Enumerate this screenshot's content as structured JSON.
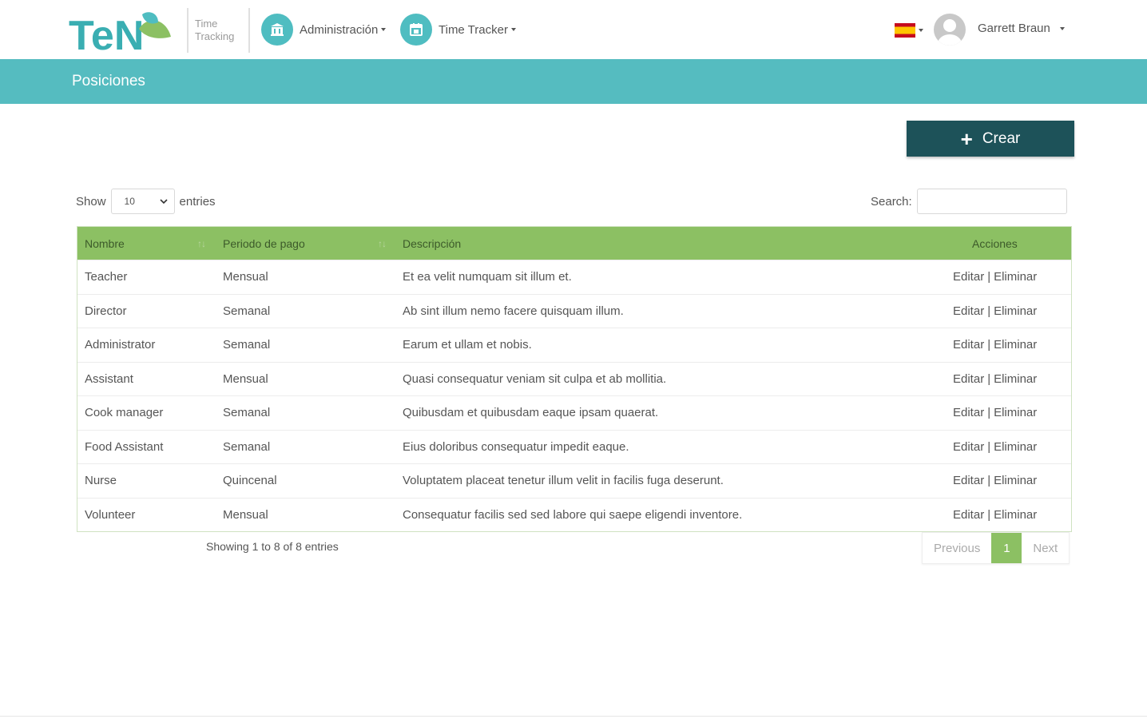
{
  "brand": {
    "logo_text": "TeN",
    "subtitle_line1": "Time",
    "subtitle_line2": "Tracking"
  },
  "nav": {
    "items": [
      {
        "label": "Administración",
        "icon": "bank-icon"
      },
      {
        "label": "Time Tracker",
        "icon": "calendar-icon"
      }
    ],
    "language_icon": "spain-flag-icon",
    "user_name": "Garrett Braun"
  },
  "page": {
    "title": "Posiciones"
  },
  "toolbar": {
    "create_label": "Crear"
  },
  "table_controls": {
    "show_label": "Show",
    "page_size": "10",
    "entries_label": "entries",
    "search_label": "Search:",
    "search_value": ""
  },
  "table": {
    "headers": [
      "Nombre",
      "Periodo de pago",
      "Descripción",
      "Acciones"
    ],
    "rows": [
      {
        "name": "Teacher",
        "period": "Mensual",
        "description": "Et ea velit numquam sit illum et."
      },
      {
        "name": "Director",
        "period": "Semanal",
        "description": "Ab sint illum nemo facere quisquam illum."
      },
      {
        "name": "Administrator",
        "period": "Semanal",
        "description": "Earum et ullam et nobis."
      },
      {
        "name": "Assistant",
        "period": "Mensual",
        "description": "Quasi consequatur veniam sit culpa et ab mollitia."
      },
      {
        "name": "Cook manager",
        "period": "Semanal",
        "description": "Quibusdam et quibusdam eaque ipsam quaerat."
      },
      {
        "name": "Food Assistant",
        "period": "Semanal",
        "description": "Eius doloribus consequatur impedit eaque."
      },
      {
        "name": "Nurse",
        "period": "Quincenal",
        "description": "Voluptatem placeat tenetur illum velit in facilis fuga deserunt."
      },
      {
        "name": "Volunteer",
        "period": "Mensual",
        "description": "Consequatur facilis sed sed labore qui saepe eligendi inventore."
      }
    ],
    "edit_label": "Editar",
    "separator": "|",
    "delete_label": "Eliminar"
  },
  "footer": {
    "info": "Showing 1 to 8 of 8 entries",
    "previous": "Previous",
    "current_page": "1",
    "next": "Next"
  },
  "colors": {
    "teal": "#55bcc0",
    "dark_teal": "#1d5259",
    "green": "#8cc063"
  }
}
